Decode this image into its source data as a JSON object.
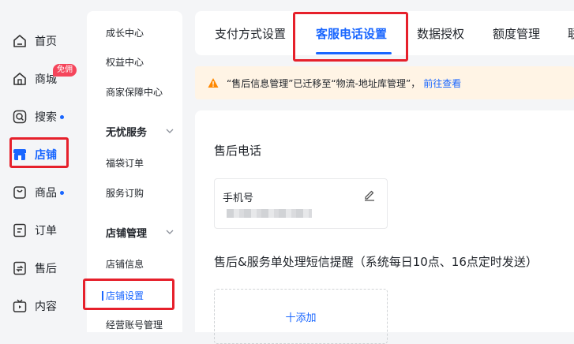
{
  "nav_main": {
    "items": [
      {
        "label": "首页",
        "icon": "home-icon"
      },
      {
        "label": "商城",
        "icon": "store-icon",
        "badge": "免佣"
      },
      {
        "label": "搜索",
        "icon": "search-icon",
        "dot": true
      },
      {
        "label": "店铺",
        "icon": "shop-icon",
        "active": true
      },
      {
        "label": "商品",
        "icon": "product-icon",
        "dot": true
      },
      {
        "label": "订单",
        "icon": "order-icon"
      },
      {
        "label": "售后",
        "icon": "aftersale-icon"
      },
      {
        "label": "内容",
        "icon": "content-icon"
      }
    ]
  },
  "nav_sub": {
    "items": [
      {
        "label": "成长中心"
      },
      {
        "label": "权益中心"
      },
      {
        "label": "商家保障中心"
      }
    ],
    "group1": {
      "label": "无忧服务",
      "items": [
        {
          "label": "福袋订单"
        },
        {
          "label": "服务订购"
        }
      ]
    },
    "group2": {
      "label": "店铺管理",
      "items": [
        {
          "label": "店铺信息"
        },
        {
          "label": "店铺设置"
        },
        {
          "label": "经营账号管理"
        }
      ]
    }
  },
  "tabs": [
    {
      "label": "支付方式设置"
    },
    {
      "label": "客服电话设置",
      "active": true
    },
    {
      "label": "数据授权"
    },
    {
      "label": "额度管理"
    },
    {
      "label": "联"
    }
  ],
  "notice": {
    "text": "“售后信息管理”已迁移至“物流-地址库管理”，",
    "link": "前往查看"
  },
  "content": {
    "section1_title": "售后电话",
    "phone_label": "手机号",
    "section2_title": "售后&服务单处理短信提醒（系统每日10点、16点定时发送）",
    "add_label": "十添加"
  },
  "colors": {
    "accent": "#1966ff",
    "highlight_box": "#e6202b",
    "badge": "#f5455b",
    "notice_bg": "#fff4e5"
  }
}
